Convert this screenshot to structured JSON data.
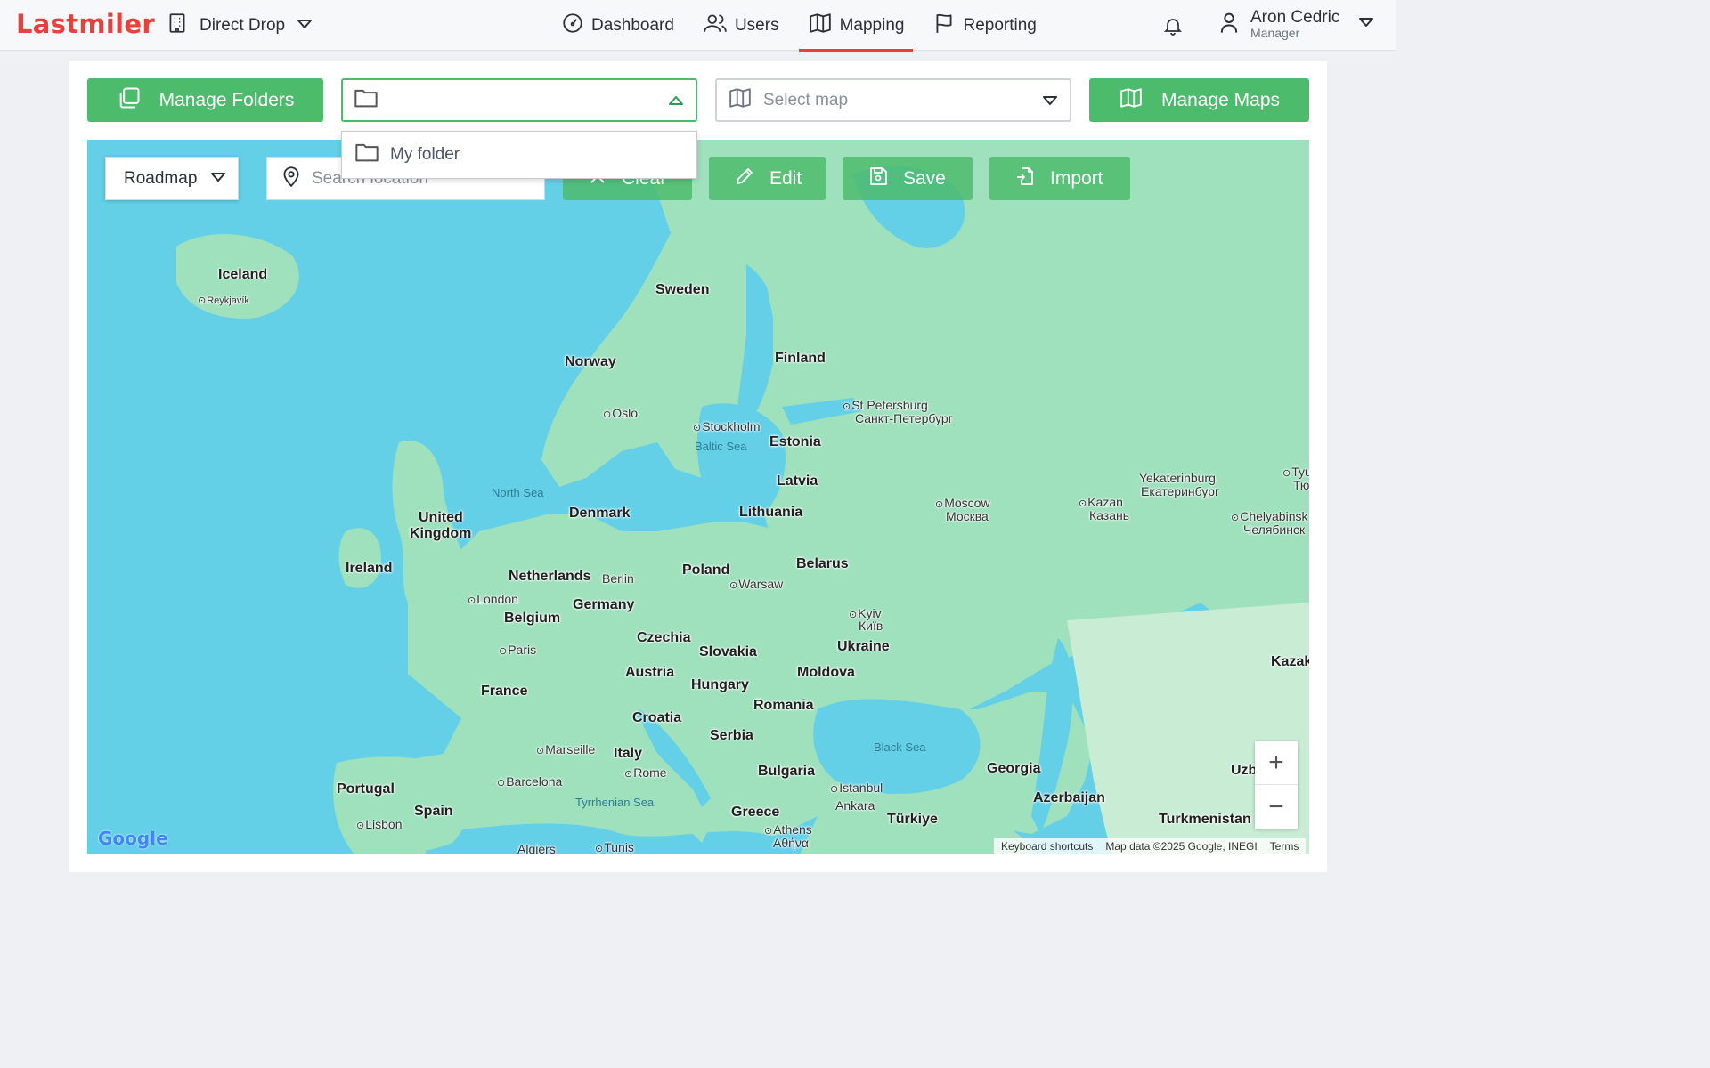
{
  "app": {
    "logo": "Lastmiler"
  },
  "org": {
    "name": "Direct Drop"
  },
  "nav": [
    {
      "label": "Dashboard",
      "icon": "dashboard-icon"
    },
    {
      "label": "Users",
      "icon": "users-icon"
    },
    {
      "label": "Mapping",
      "icon": "map-icon",
      "active": true
    },
    {
      "label": "Reporting",
      "icon": "flag-icon"
    }
  ],
  "user": {
    "name": "Aron Cedric",
    "role": "Manager"
  },
  "toolbar": {
    "manage_folders": "Manage Folders",
    "folder_value": "",
    "folder_options": [
      "My folder"
    ],
    "map_placeholder": "Select map",
    "manage_maps": "Manage Maps"
  },
  "map": {
    "type": "Roadmap",
    "search_placeholder": "Search location",
    "clear": "Clear",
    "edit": "Edit",
    "save": "Save",
    "import": "Import",
    "zoom_in": "+",
    "zoom_out": "−",
    "google": "Google",
    "attribution": [
      "Keyboard shortcuts",
      "Map data ©2025 Google, INEGI",
      "Terms"
    ],
    "labels": {
      "iceland": "Iceland",
      "reykjavik": "Reykjavík",
      "sweden": "Sweden",
      "norway": "Norway",
      "finland": "Finland",
      "oslo": "Oslo",
      "stockholm": "Stockholm",
      "baltic": "Baltic Sea",
      "estonia": "Estonia",
      "stpetersburg": "St Petersburg",
      "stpetersburg_ru": "Санкт-Петербург",
      "latvia": "Latvia",
      "northsea": "North Sea",
      "denmark": "Denmark",
      "uk1": "United",
      "uk2": "Kingdom",
      "lithuania": "Lithuania",
      "moscow": "Moscow",
      "moscow_ru": "Москва",
      "kazan": "Kazan",
      "kazan_ru": "Казань",
      "yekaterinburg": "Yekaterinburg",
      "yekaterinburg_ru": "Екатеринбург",
      "chelyabinsk": "Chelyabinsk",
      "chelyabinsk_ru": "Челябинск",
      "ireland": "Ireland",
      "netherlands": "Netherlands",
      "berlin": "Berlin",
      "poland": "Poland",
      "belarus": "Belarus",
      "london": "London",
      "germany": "Germany",
      "warsaw": "Warsaw",
      "belgium": "Belgium",
      "kyiv": "Kyiv",
      "kyiv_ua": "Київ",
      "czechia": "Czechia",
      "paris": "Paris",
      "slovakia": "Slovakia",
      "ukraine": "Ukraine",
      "austria": "Austria",
      "moldova": "Moldova",
      "hungary": "Hungary",
      "france": "France",
      "romania": "Romania",
      "croatia": "Croatia",
      "serbia": "Serbia",
      "blacksea": "Black Sea",
      "marseille": "Marseille",
      "italy": "Italy",
      "rome": "Rome",
      "georgia": "Georgia",
      "bulgaria": "Bulgaria",
      "barcelona": "Barcelona",
      "portugal": "Portugal",
      "istanbul": "Istanbul",
      "azerbaijan": "Azerbaijan",
      "ankara": "Ankara",
      "spain": "Spain",
      "tyrrhenian": "Tyrrhenian Sea",
      "greece": "Greece",
      "turkiye": "Türkiye",
      "turkmenistan": "Turkmenistan",
      "lisbon": "Lisbon",
      "athens": "Athens",
      "athens_gr": "Αθήνα",
      "algiers": "Algiers",
      "tunis": "Tunis",
      "kazak": "Kazak",
      "uzb": "Uzb",
      "tyu": "Tyu",
      "tyu2": "Тю"
    }
  },
  "colors": {
    "brand": "#e8413b",
    "accent": "#4cbb6c",
    "sea": "#63d0e8",
    "land": "#9fe0bd"
  }
}
